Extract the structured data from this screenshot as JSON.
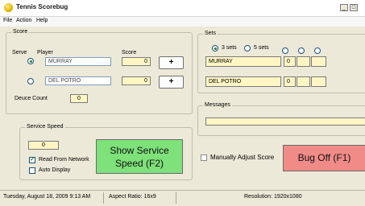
{
  "window": {
    "title": "Tennis Scorebug",
    "controls": {
      "minimize": "_",
      "maximize": "□"
    }
  },
  "menu": [
    "File",
    "Action",
    "Help"
  ],
  "score_group": {
    "legend": "Score",
    "col_serve": "Serve",
    "col_player": "Player",
    "col_score": "Score",
    "players": [
      {
        "name": "MURRAY",
        "score": "0",
        "serving": true,
        "add_label": "+"
      },
      {
        "name": "DEL POTRO",
        "score": "0",
        "serving": false,
        "add_label": "+"
      }
    ],
    "deuce_label": "Deuce Count",
    "deuce_value": "0"
  },
  "sets_group": {
    "legend": "Sets",
    "option_3": "3 sets",
    "option_5": "5 sets",
    "selected": "3 sets",
    "rows": [
      {
        "name": "MURRAY",
        "sets": [
          "0",
          "",
          ""
        ]
      },
      {
        "name": "DEL POTRO",
        "sets": [
          "0",
          "",
          ""
        ]
      }
    ]
  },
  "messages_group": {
    "legend": "Messages",
    "value": ""
  },
  "service_speed": {
    "legend": "Service Speed",
    "value": "0",
    "read_from_network": "Read From Network",
    "read_from_network_checked": true,
    "auto_display": "Auto Display",
    "auto_display_checked": false,
    "show_button": "Show Service\nSpeed (F2)"
  },
  "manual_adjust": {
    "label": "Manually Adjust Score",
    "checked": false
  },
  "bug_off_button": "Bug Off (F1)",
  "status": {
    "datetime": "Tuesday, August 18, 2009 9:13 AM",
    "aspect": "Aspect Ratio: 16x9",
    "resolution": "Resolution: 1920x1080"
  },
  "colors": {
    "show_speed_bg": "#7ee17a",
    "bug_off_bg": "#f08b88",
    "field_yellow": "#fff6c4",
    "accent_green": "#2a7a22"
  }
}
